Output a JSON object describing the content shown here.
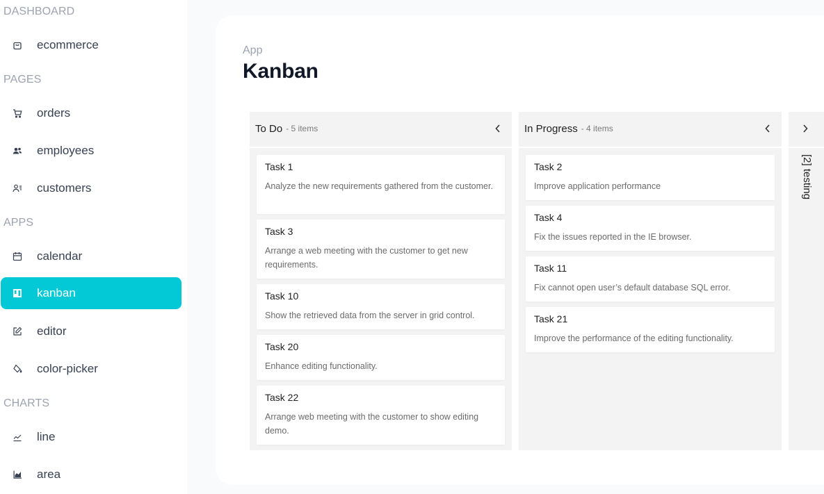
{
  "sidebar": {
    "sections": [
      {
        "title": "DASHBOARD",
        "items": [
          {
            "label": "ecommerce",
            "icon": "shopping-bag-icon"
          }
        ]
      },
      {
        "title": "PAGES",
        "items": [
          {
            "label": "orders",
            "icon": "cart-icon"
          },
          {
            "label": "employees",
            "icon": "people-icon"
          },
          {
            "label": "customers",
            "icon": "contacts-icon"
          }
        ]
      },
      {
        "title": "APPS",
        "items": [
          {
            "label": "calendar",
            "icon": "calendar-icon"
          },
          {
            "label": "kanban",
            "icon": "kanban-icon",
            "active": true
          },
          {
            "label": "editor",
            "icon": "edit-icon"
          },
          {
            "label": "color-picker",
            "icon": "paint-bucket-icon"
          }
        ]
      },
      {
        "title": "CHARTS",
        "items": [
          {
            "label": "line",
            "icon": "line-chart-icon"
          },
          {
            "label": "area",
            "icon": "area-chart-icon"
          }
        ]
      }
    ],
    "active_color": "#03c9d7"
  },
  "header": {
    "breadcrumb": "App",
    "title": "Kanban"
  },
  "board": {
    "columns": [
      {
        "title": "To Do",
        "count": "- 5 items",
        "cards": [
          {
            "title": "Task 1",
            "desc": "Analyze the new requirements gathered from the customer."
          },
          {
            "title": "Task 3",
            "desc": "Arrange a web meeting with the customer to get new requirements."
          },
          {
            "title": "Task 10",
            "desc": "Show the retrieved data from the server in grid control."
          },
          {
            "title": "Task 20",
            "desc": "Enhance editing functionality."
          },
          {
            "title": "Task 22",
            "desc": "Arrange web meeting with the customer to show editing demo."
          }
        ]
      },
      {
        "title": "In Progress",
        "count": "- 4 items",
        "cards": [
          {
            "title": "Task 2",
            "desc": "Improve application performance"
          },
          {
            "title": "Task 4",
            "desc": "Fix the issues reported in the IE browser."
          },
          {
            "title": "Task 11",
            "desc": "Fix cannot open user’s default database SQL error."
          },
          {
            "title": "Task 21",
            "desc": "Improve the performance of the editing functionality."
          }
        ]
      }
    ],
    "collapsed_column": {
      "label": "[2] testing"
    }
  }
}
